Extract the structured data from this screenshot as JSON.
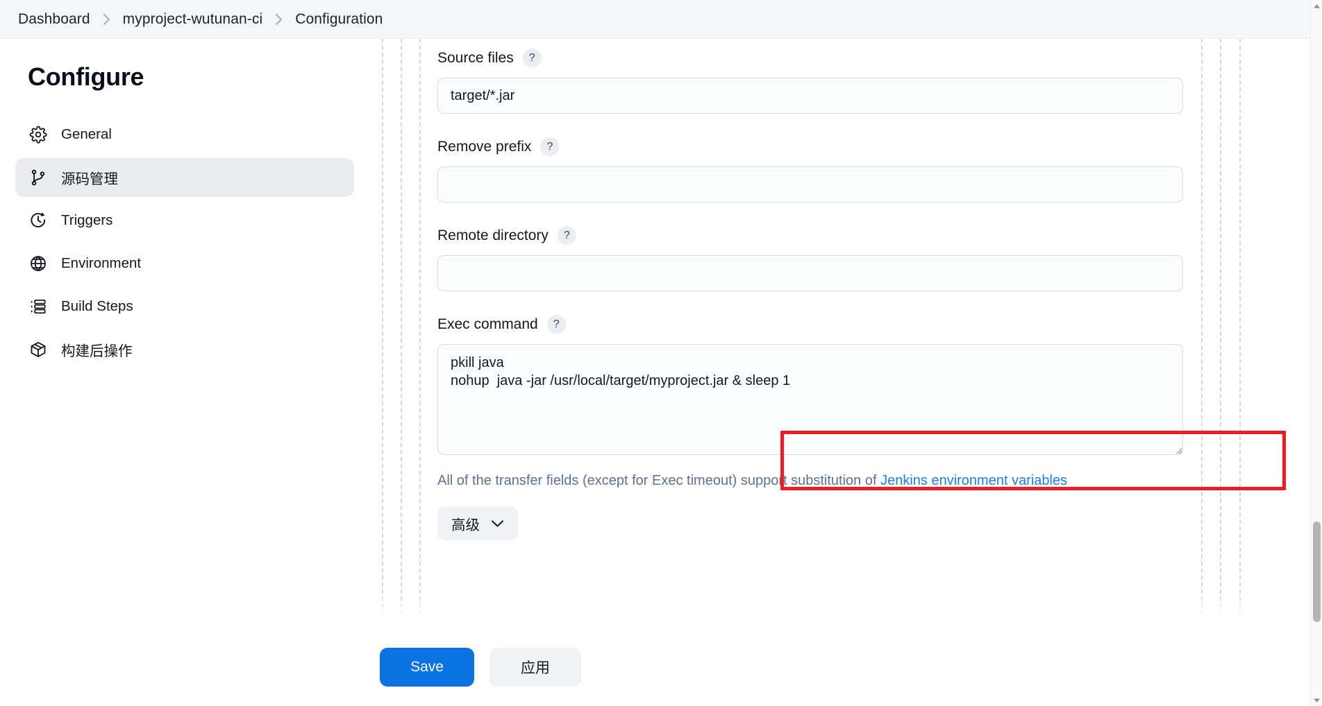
{
  "breadcrumb": {
    "items": [
      {
        "label": "Dashboard"
      },
      {
        "label": "myproject-wutunan-ci"
      },
      {
        "label": "Configuration"
      }
    ],
    "separator_icon": "chevron-right-icon"
  },
  "sidebar": {
    "title": "Configure",
    "items": [
      {
        "label": "General",
        "icon": "gear-icon",
        "active": false
      },
      {
        "label": "源码管理",
        "icon": "git-branch-icon",
        "active": true
      },
      {
        "label": "Triggers",
        "icon": "clock-icon",
        "active": false
      },
      {
        "label": "Environment",
        "icon": "globe-icon",
        "active": false
      },
      {
        "label": "Build Steps",
        "icon": "list-icon",
        "active": false
      },
      {
        "label": "构建后操作",
        "icon": "package-icon",
        "active": false
      }
    ]
  },
  "form": {
    "help_icon": "?",
    "fields": [
      {
        "label": "Source files",
        "type": "input",
        "value": "target/*.jar",
        "placeholder": ""
      },
      {
        "label": "Remove prefix",
        "type": "input",
        "value": "",
        "placeholder": ""
      },
      {
        "label": "Remote directory",
        "type": "input",
        "value": "",
        "placeholder": ""
      },
      {
        "label": "Exec command",
        "type": "textarea",
        "value": "pkill java\nnohup  java -jar /usr/local/target/myproject.jar & sleep 1",
        "placeholder": "",
        "highlighted": true
      }
    ],
    "helper": {
      "text_before": "All of the transfer fields (except for Exec timeout) support substitution of ",
      "link_text": "Jenkins environment variables"
    },
    "advanced_button": {
      "label": "高级",
      "icon": "chevron-down-icon"
    }
  },
  "bottom_bar": {
    "save_label": "Save",
    "apply_label": "应用"
  },
  "annotation": {
    "type": "rectangle-highlight",
    "color": "#ee1c21",
    "target": "exec-command-textarea"
  },
  "scrollbar": {
    "up_icon": "triangle-up-icon",
    "down_icon": "triangle-down-icon"
  },
  "colors": {
    "accent_blue": "#0b72e2",
    "link_blue": "#1b7ef3",
    "highlight_red": "#ee1c21",
    "sidebar_active_bg": "#ebecf0",
    "breadcrumb_bg": "#f5f6f8"
  }
}
